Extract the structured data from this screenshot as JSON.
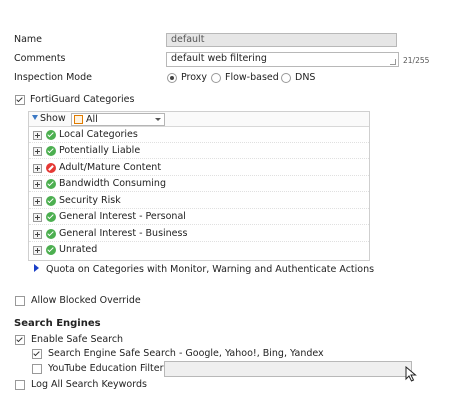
{
  "form": {
    "name_label": "Name",
    "name_value": "default",
    "comments_label": "Comments",
    "comments_value": "default web filtering",
    "comments_count": "21/255",
    "inspection_label": "Inspection Mode",
    "inspection_options": [
      "Proxy",
      "Flow-based",
      "DNS"
    ],
    "inspection_selected": "Proxy"
  },
  "fortiguard": {
    "enabled": true,
    "label": "FortiGuard Categories",
    "show_label": "Show",
    "show_value": "All",
    "categories": [
      {
        "label": "Local Categories",
        "status": "allow"
      },
      {
        "label": "Potentially Liable",
        "status": "allow"
      },
      {
        "label": "Adult/Mature Content",
        "status": "block"
      },
      {
        "label": "Bandwidth Consuming",
        "status": "allow"
      },
      {
        "label": "Security Risk",
        "status": "allow"
      },
      {
        "label": "General Interest - Personal",
        "status": "allow"
      },
      {
        "label": "General Interest - Business",
        "status": "allow"
      },
      {
        "label": "Unrated",
        "status": "allow"
      }
    ],
    "quota_label": "Quota on Categories with Monitor, Warning and Authenticate Actions"
  },
  "allow_blocked_override": {
    "label": "Allow Blocked Override",
    "checked": false
  },
  "search_engines": {
    "heading": "Search Engines",
    "enable_safe_search": {
      "label": "Enable Safe Search",
      "checked": true
    },
    "search_engine_safe_search": {
      "label": "Search Engine Safe Search - Google, Yahoo!, Bing, Yandex",
      "checked": true
    },
    "youtube_filter": {
      "label": "YouTube Education Filter",
      "checked": false,
      "value": ""
    },
    "log_keywords": {
      "label": "Log All Search Keywords",
      "checked": false
    }
  },
  "colors": {
    "allow": "#4caf50",
    "block": "#e53935",
    "accent": "#1a3fc7"
  }
}
